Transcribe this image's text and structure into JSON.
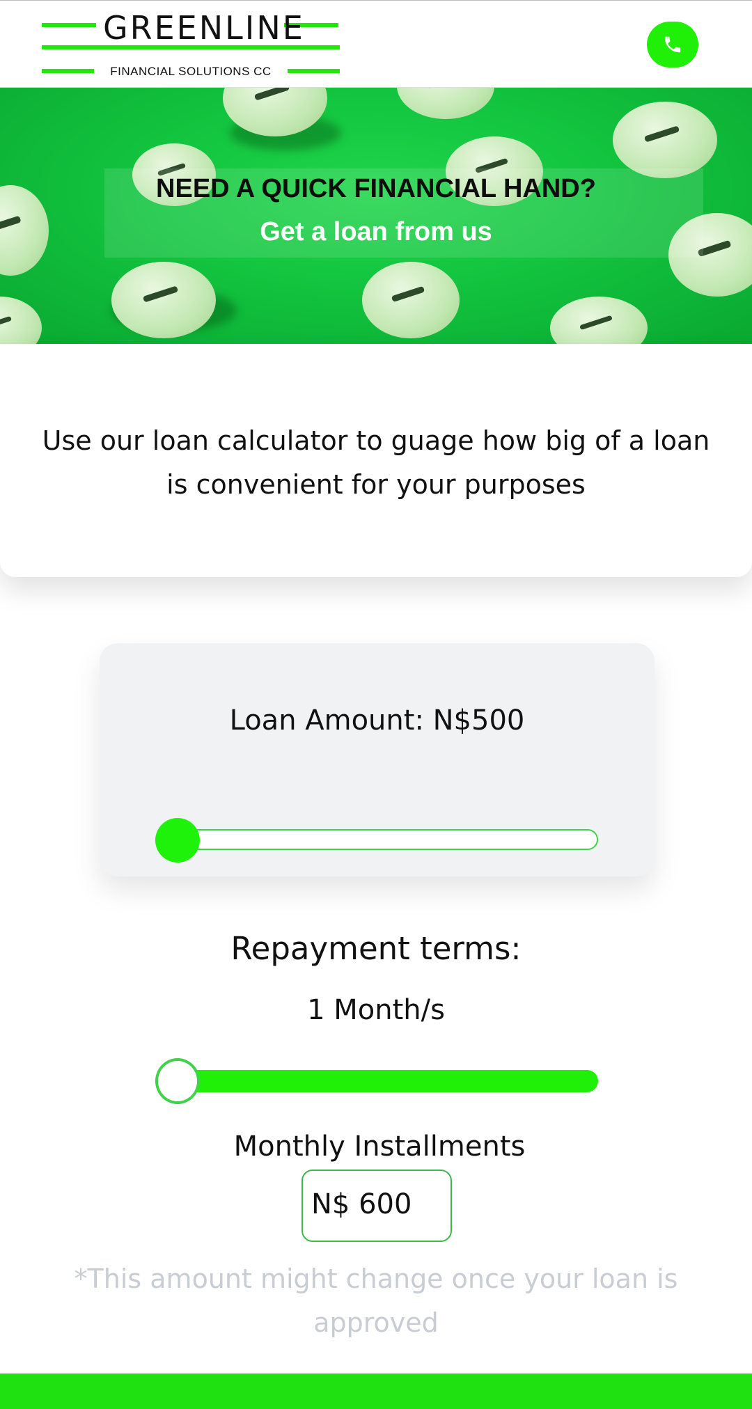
{
  "header": {
    "logo_brand": "GREENLINE",
    "logo_tagline": "FINANCIAL SOLUTIONS CC",
    "phone_icon": "phone-icon"
  },
  "hero": {
    "title": "NEED A QUICK FINANCIAL HAND?",
    "subtitle": "Get a loan from us"
  },
  "intro": {
    "text": "Use our loan calculator to guage how big of a loan is convenient for your purposes"
  },
  "calculator": {
    "loan_amount_label": "Loan Amount: N$500",
    "loan_slider_fraction": 0.0,
    "repayment_title": "Repayment terms:",
    "repayment_value": "1 Month/s",
    "repayment_slider_fraction": 0.0,
    "installments_label": "Monthly Installments",
    "installments_value": "N$ 600",
    "disclaimer": "*This amount might change once your loan is approved"
  },
  "colors": {
    "accent": "#20f008",
    "hero_green": "#12c43f",
    "disclaimer_gray": "#c8ccd3"
  }
}
